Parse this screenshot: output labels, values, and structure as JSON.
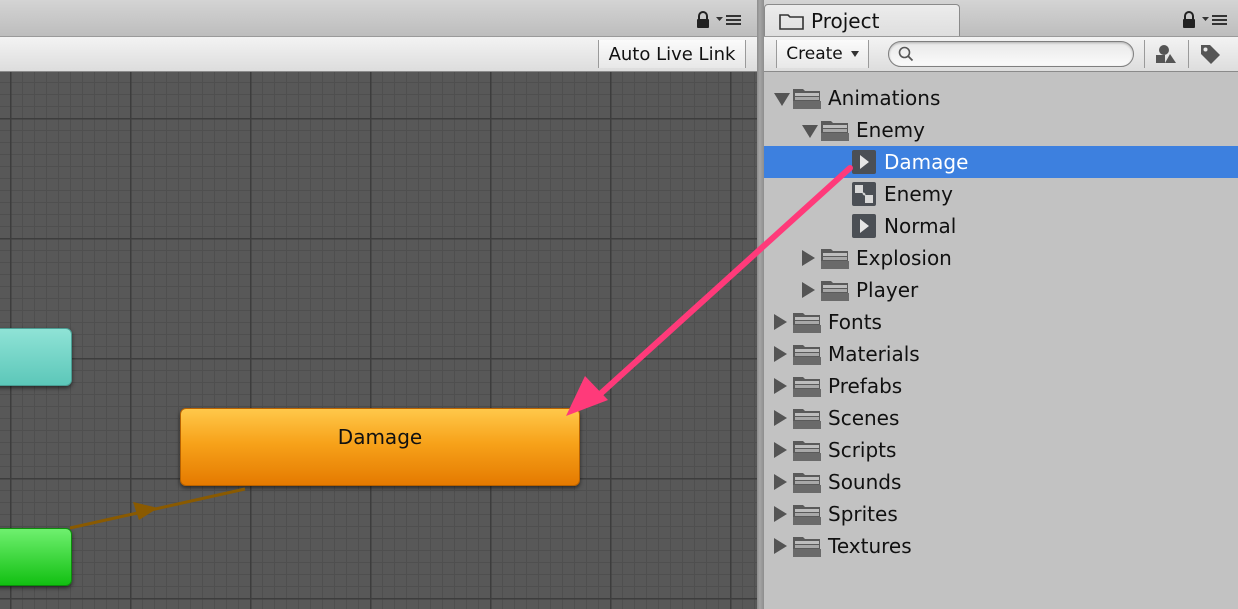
{
  "animator": {
    "toolbar": {
      "auto_live_link_label": "Auto Live Link"
    },
    "states": {
      "damage_label": "Damage"
    },
    "colors": {
      "cyan_state": "#6fd3c6",
      "green_state": "#1ccf1c",
      "damage_state": "#f4a01d",
      "transition": "#8a5a00",
      "drag_arrow": "#ff3a7a"
    }
  },
  "project": {
    "tab_label": "Project",
    "create_label": "Create",
    "search": {
      "placeholder": "",
      "value": ""
    },
    "tree": [
      {
        "label": "Animations",
        "kind": "folder",
        "depth": 0,
        "expanded": true
      },
      {
        "label": "Enemy",
        "kind": "folder",
        "depth": 1,
        "expanded": true
      },
      {
        "label": "Damage",
        "kind": "clip",
        "depth": 2,
        "selected": true
      },
      {
        "label": "Enemy",
        "kind": "controller",
        "depth": 2
      },
      {
        "label": "Normal",
        "kind": "clip",
        "depth": 2
      },
      {
        "label": "Explosion",
        "kind": "folder",
        "depth": 1,
        "expanded": false
      },
      {
        "label": "Player",
        "kind": "folder",
        "depth": 1,
        "expanded": false
      },
      {
        "label": "Fonts",
        "kind": "folder",
        "depth": 0,
        "expanded": false
      },
      {
        "label": "Materials",
        "kind": "folder",
        "depth": 0,
        "expanded": false
      },
      {
        "label": "Prefabs",
        "kind": "folder",
        "depth": 0,
        "expanded": false
      },
      {
        "label": "Scenes",
        "kind": "folder",
        "depth": 0,
        "expanded": false
      },
      {
        "label": "Scripts",
        "kind": "folder",
        "depth": 0,
        "expanded": false
      },
      {
        "label": "Sounds",
        "kind": "folder",
        "depth": 0,
        "expanded": false
      },
      {
        "label": "Sprites",
        "kind": "folder",
        "depth": 0,
        "expanded": false
      },
      {
        "label": "Textures",
        "kind": "folder",
        "depth": 0,
        "expanded": false
      }
    ],
    "colors": {
      "selection": "#3d80df"
    }
  }
}
